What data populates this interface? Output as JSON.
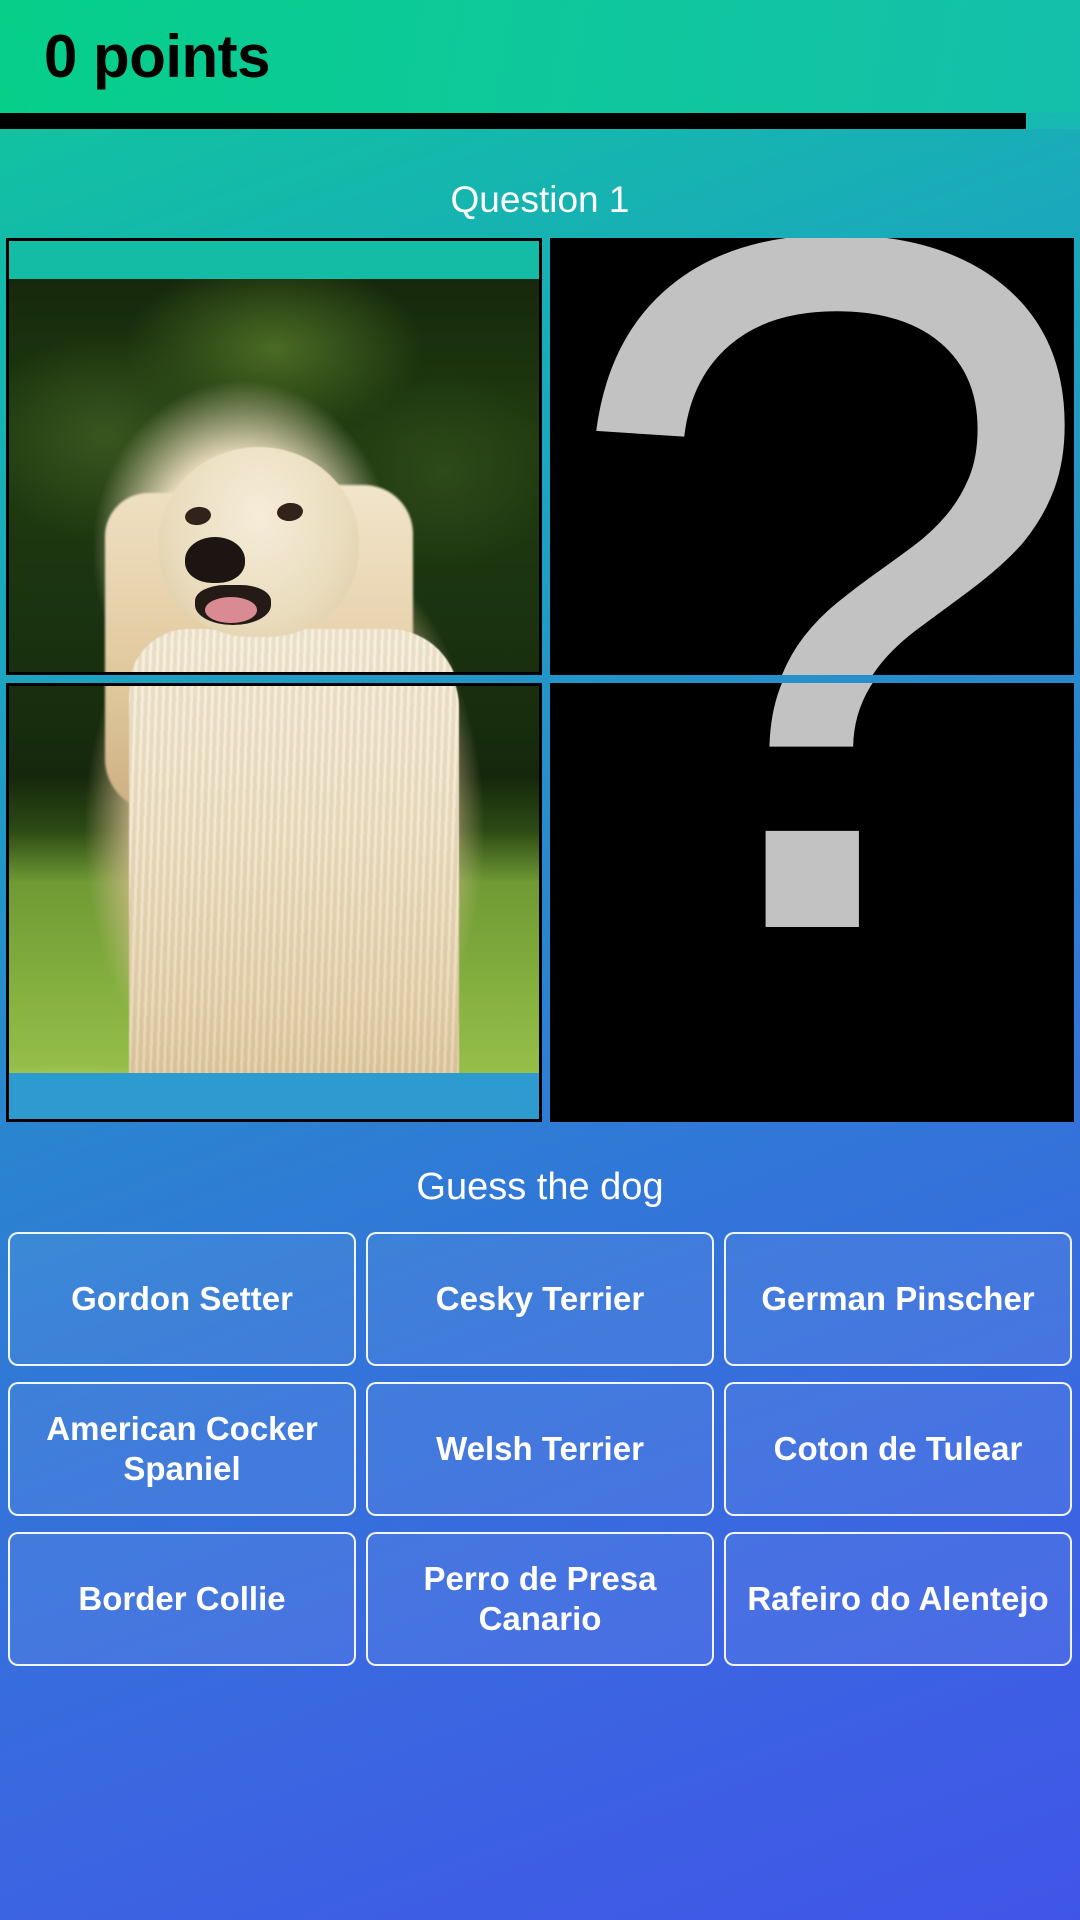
{
  "header": {
    "score_label": "0 points"
  },
  "progress": {
    "percent": 95
  },
  "quiz": {
    "question_label": "Question 1",
    "prompt": "Guess the dog"
  },
  "puzzle": {
    "tiles": [
      {
        "name": "tile-top-left",
        "revealed": true,
        "alt": "dog-photo-top-left"
      },
      {
        "name": "tile-top-right",
        "revealed": false,
        "alt": "question-mark-icon"
      },
      {
        "name": "tile-bottom-left",
        "revealed": true,
        "alt": "dog-photo-bottom-left"
      },
      {
        "name": "tile-bottom-right",
        "revealed": false,
        "alt": "question-mark-icon"
      }
    ],
    "hidden_glyph": "?"
  },
  "answers": [
    {
      "label": "Gordon Setter"
    },
    {
      "label": "Cesky Terrier"
    },
    {
      "label": "German Pinscher"
    },
    {
      "label": "American Cocker Spaniel"
    },
    {
      "label": "Welsh Terrier"
    },
    {
      "label": "Coton de Tulear"
    },
    {
      "label": "Border Collie"
    },
    {
      "label": "Perro de Presa Canario"
    },
    {
      "label": "Rafeiro do Alentejo"
    }
  ],
  "colors": {
    "header_green": "#0ec99a",
    "progress_fill": "#000000",
    "page_top": "#12c894",
    "page_bottom": "#4055e8",
    "answer_text": "#ffffff",
    "hidden_tile_bg": "#000000",
    "hidden_tile_glyph": "#c2c2c2"
  }
}
